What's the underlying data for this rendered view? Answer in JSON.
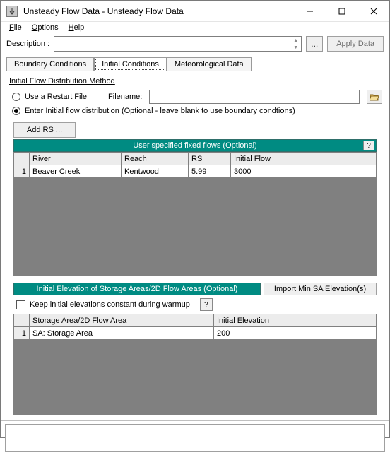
{
  "window": {
    "title": "Unsteady Flow Data - Unsteady Flow Data"
  },
  "menu": {
    "file": "File",
    "options": "Options",
    "help": "Help"
  },
  "description": {
    "label": "Description :",
    "value": "",
    "ellipsis": "...",
    "apply": "Apply Data"
  },
  "tabs": {
    "boundary": "Boundary Conditions",
    "initial": "Initial Conditions",
    "meteo": "Meteorological Data"
  },
  "ifdm": {
    "title": "Initial Flow Distribution Method",
    "restart_label": "Use a Restart File",
    "filename_label": "Filename:",
    "filename_value": "",
    "enter_label": "Enter Initial flow distribution (Optional - leave blank to use boundary condtions)"
  },
  "add_rs": "Add RS ...",
  "fixed_flows": {
    "header": "User specified fixed flows (Optional)",
    "cols": {
      "river": "River",
      "reach": "Reach",
      "rs": "RS",
      "iflow": "Initial Flow"
    },
    "rows": [
      {
        "n": "1",
        "river": "Beaver Creek",
        "reach": "Kentwood",
        "rs": "5.99",
        "iflow": "3000"
      }
    ]
  },
  "sa": {
    "header": "Initial Elevation of Storage Areas/2D Flow Areas (Optional)",
    "import_label": "Import Min SA Elevation(s)",
    "keep_label": "Keep initial elevations constant during warmup",
    "cols": {
      "area": "Storage Area/2D Flow Area",
      "elev": "Initial Elevation"
    },
    "rows": [
      {
        "n": "1",
        "area": "SA: Storage Area",
        "elev": "200"
      }
    ]
  },
  "help_glyph": "?"
}
